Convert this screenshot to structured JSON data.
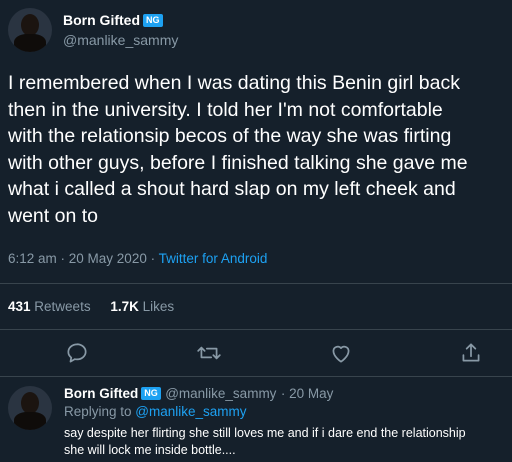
{
  "tweet": {
    "author_name": "Born Gifted",
    "author_badge": "NG",
    "author_handle": "@manlike_sammy",
    "text": "I remembered when I was dating this Benin girl back\nthen in the university. I told her I'm not comfortable\nwith the relationsip becos of the way she was firting\nwith other guys, before I finished talking she gave me\nwhat i called a shout hard slap on my left cheek and\nwent on to",
    "time": "6:12 am · 20 May 2020 · ",
    "source": "Twitter for Android",
    "retweets_count": "431",
    "retweets_label": "Retweets",
    "likes_count": "1.7K",
    "likes_label": "Likes"
  },
  "actions": {
    "reply_icon": "comment-icon",
    "retweet_icon": "retweet-icon",
    "like_icon": "heart-icon",
    "share_icon": "share-icon"
  },
  "reply": {
    "author_name": "Born Gifted",
    "author_badge": "NG",
    "author_handle": "@manlike_sammy",
    "date": "· 20 May",
    "replying_prefix": "Replying to ",
    "replying_handle": "@manlike_sammy",
    "text": "say despite her flirting she still loves me and if i dare end the relationship\nshe will lock me inside bottle...."
  },
  "colors": {
    "background": "#15202b",
    "accent": "#1da1f2",
    "secondary_text": "#8899a6",
    "divider": "#38444d"
  }
}
